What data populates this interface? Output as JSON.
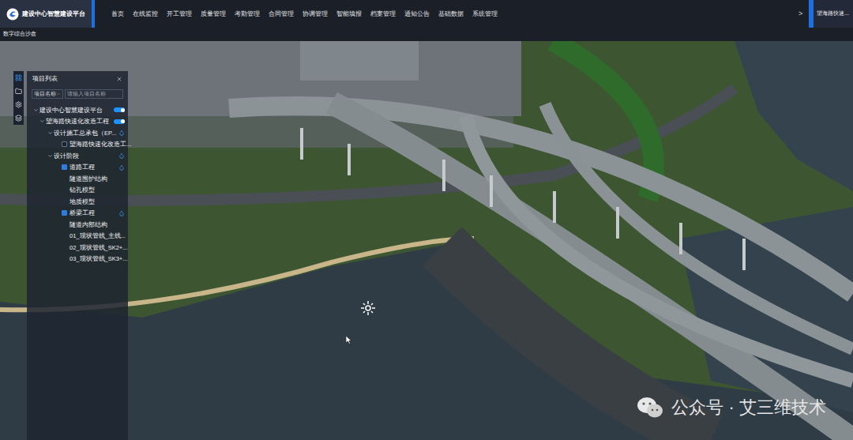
{
  "header": {
    "logo_text": "建设中心智慧建设平台",
    "nav": [
      {
        "label": "首页",
        "selected": false
      },
      {
        "label": "在线监控",
        "selected": false
      },
      {
        "label": "开工管理",
        "selected": false
      },
      {
        "label": "质量管理",
        "selected": false
      },
      {
        "label": "考勤管理",
        "selected": false
      },
      {
        "label": "合同管理",
        "selected": false
      },
      {
        "label": "协调管理",
        "selected": false
      },
      {
        "label": "智能填报",
        "selected": false
      },
      {
        "label": "档案管理",
        "selected": false
      },
      {
        "label": "通知公告",
        "selected": false
      },
      {
        "label": "基础数据",
        "selected": false
      },
      {
        "label": "系统管理",
        "selected": false
      }
    ],
    "arrow": ">",
    "project_select": "望海路快速..."
  },
  "breadcrumb": "数字综合沙盘",
  "panel": {
    "title": "项目列表",
    "filter_select": "项目名称",
    "search_placeholder": "请输入项目名称",
    "tree": [
      {
        "label": "建设中心智慧建设平台",
        "depth": 0,
        "kind": "branch",
        "expanded": true,
        "checked": false,
        "on": true,
        "locate": false
      },
      {
        "label": "望海路快速化改造工程",
        "depth": 1,
        "kind": "branch",
        "expanded": true,
        "checked": false,
        "on": true,
        "locate": false
      },
      {
        "label": "设计施工总承包（EP...",
        "depth": 2,
        "kind": "branch",
        "expanded": true,
        "checked": false,
        "on": false,
        "locate": true
      },
      {
        "label": "望海路快速化改造工...",
        "depth": 3,
        "kind": "check",
        "expanded": false,
        "checked": false,
        "on": false,
        "locate": false
      },
      {
        "label": "设计阶段",
        "depth": 2,
        "kind": "branch",
        "expanded": true,
        "checked": false,
        "on": false,
        "locate": true
      },
      {
        "label": "道路工程",
        "depth": 3,
        "kind": "check",
        "expanded": false,
        "checked": true,
        "on": false,
        "locate": true
      },
      {
        "label": "隧道围护结构",
        "depth": 4,
        "kind": "plain",
        "expanded": false,
        "checked": false,
        "on": false,
        "locate": false
      },
      {
        "label": "钻孔模型",
        "depth": 4,
        "kind": "plain",
        "expanded": false,
        "checked": false,
        "on": false,
        "locate": false
      },
      {
        "label": "地质模型",
        "depth": 4,
        "kind": "plain",
        "expanded": false,
        "checked": false,
        "on": false,
        "locate": false
      },
      {
        "label": "桥梁工程",
        "depth": 3,
        "kind": "check",
        "expanded": false,
        "checked": true,
        "on": false,
        "locate": true
      },
      {
        "label": "隧道内部结构",
        "depth": 4,
        "kind": "plain",
        "expanded": false,
        "checked": false,
        "on": false,
        "locate": false
      },
      {
        "label": "01_现状管线_主线...",
        "depth": 4,
        "kind": "plain",
        "expanded": false,
        "checked": false,
        "on": false,
        "locate": false
      },
      {
        "label": "02_现状管线_SK2+...",
        "depth": 4,
        "kind": "plain",
        "expanded": false,
        "checked": false,
        "on": false,
        "locate": false
      },
      {
        "label": "03_现状管线_SK3+...",
        "depth": 4,
        "kind": "plain",
        "expanded": false,
        "checked": false,
        "on": false,
        "locate": false
      }
    ]
  },
  "watermark": "公众号 · 艾三维技术"
}
